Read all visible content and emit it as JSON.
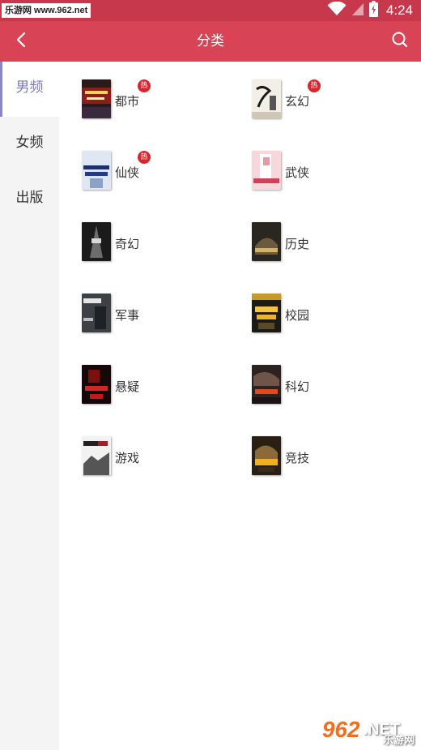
{
  "statusbar": {
    "watermark": "乐游网 www.962.net",
    "time": "4:24",
    "icons": [
      "wifi-icon",
      "signal-icon",
      "battery-charging-icon"
    ]
  },
  "appbar": {
    "title": "分类",
    "back_icon": "chevron-left-icon",
    "search_icon": "search-icon",
    "color": "#d84356"
  },
  "sidebar": {
    "items": [
      {
        "label": "男频",
        "active": true
      },
      {
        "label": "女频",
        "active": false
      },
      {
        "label": "出版",
        "active": false
      }
    ],
    "active_color": "#7b79b8"
  },
  "categories": [
    {
      "label": "都市",
      "hot": "热",
      "cover": "dark-red"
    },
    {
      "label": "玄幻",
      "hot": "热",
      "cover": "ink"
    },
    {
      "label": "仙侠",
      "hot": "热",
      "cover": "blue"
    },
    {
      "label": "武侠",
      "hot": "",
      "cover": "pink"
    },
    {
      "label": "奇幻",
      "hot": "",
      "cover": "grey"
    },
    {
      "label": "历史",
      "hot": "",
      "cover": "brown"
    },
    {
      "label": "军事",
      "hot": "",
      "cover": "slate"
    },
    {
      "label": "校园",
      "hot": "",
      "cover": "gold"
    },
    {
      "label": "悬疑",
      "hot": "",
      "cover": "blood"
    },
    {
      "label": "科幻",
      "hot": "",
      "cover": "ember"
    },
    {
      "label": "游戏",
      "hot": "",
      "cover": "white"
    },
    {
      "label": "竞技",
      "hot": "",
      "cover": "amber"
    }
  ],
  "watermark_bottom": {
    "num": "962",
    "net": ".NET",
    "cn": "乐游网"
  }
}
